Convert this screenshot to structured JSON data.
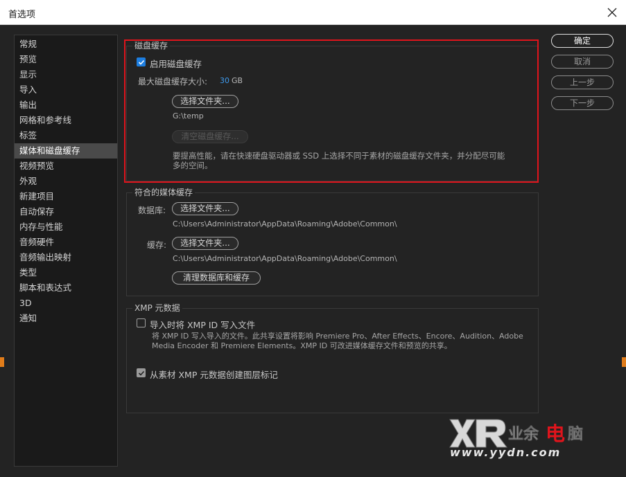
{
  "window": {
    "title": "首选项"
  },
  "sidebar": {
    "items": [
      {
        "label": "常规"
      },
      {
        "label": "预览"
      },
      {
        "label": "显示"
      },
      {
        "label": "导入"
      },
      {
        "label": "输出"
      },
      {
        "label": "网格和参考线"
      },
      {
        "label": "标签"
      },
      {
        "label": "媒体和磁盘缓存"
      },
      {
        "label": "视频预览"
      },
      {
        "label": "外观"
      },
      {
        "label": "新建项目"
      },
      {
        "label": "自动保存"
      },
      {
        "label": "内存与性能"
      },
      {
        "label": "音频硬件"
      },
      {
        "label": "音频输出映射"
      },
      {
        "label": "类型"
      },
      {
        "label": "脚本和表达式"
      },
      {
        "label": "3D"
      },
      {
        "label": "通知"
      }
    ],
    "active_index": 7
  },
  "disk_cache": {
    "title": "磁盘缓存",
    "enable_label": "启用磁盘缓存",
    "enabled": true,
    "max_size_label": "最大磁盘缓存大小:",
    "max_size_value": "30",
    "max_size_unit": "GB",
    "choose_folder_label": "选择文件夹...",
    "folder_path": "G:\\temp",
    "clear_label": "清空磁盘缓存...",
    "hint_line1": "要提高性能，请在快速硬盘驱动器或 SSD 上选择不同于素材的磁盘缓存文件夹，并分配尽可能",
    "hint_line2": "多的空间。"
  },
  "media_cache": {
    "title": "符合的媒体缓存",
    "database_label": "数据库:",
    "database_button": "选择文件夹...",
    "database_path": "C:\\Users\\Administrator\\AppData\\Roaming\\Adobe\\Common\\",
    "cache_label": "缓存:",
    "cache_button": "选择文件夹...",
    "cache_path": "C:\\Users\\Administrator\\AppData\\Roaming\\Adobe\\Common\\",
    "clean_button": "清理数据库和缓存"
  },
  "xmp": {
    "title": "XMP 元数据",
    "write_id_label": "导入时将 XMP ID 写入文件",
    "write_id_checked": false,
    "desc_line1": "将 XMP ID 写入导入的文件。此共享设置将影响 Premiere Pro、After Effects、Encore、Audition、Adobe",
    "desc_line2": "Media Encoder 和 Premiere Elements。XMP ID 可改进媒体缓存文件和预览的共享。",
    "layer_markers_label": "从素材 XMP 元数据创建图层标记",
    "layer_markers_checked": true
  },
  "actions": {
    "ok": "确定",
    "cancel": "取消",
    "prev": "上一步",
    "next": "下一步"
  },
  "watermark": {
    "logo_text": "业余电脑",
    "url": "www.yydn.com"
  },
  "colors": {
    "accent_blue": "#1d7ee0",
    "highlight_red": "#e0141c"
  }
}
